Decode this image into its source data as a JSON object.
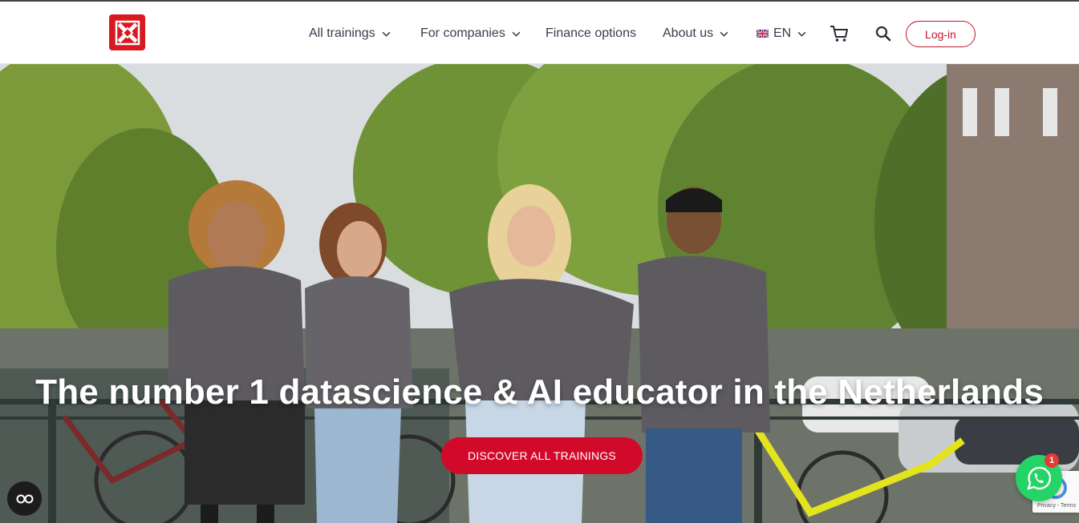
{
  "header": {
    "logo_name": "cross-logo",
    "nav": [
      {
        "label": "All trainings",
        "has_dropdown": true
      },
      {
        "label": "For companies",
        "has_dropdown": true
      },
      {
        "label": "Finance options",
        "has_dropdown": false
      },
      {
        "label": "About us",
        "has_dropdown": true
      },
      {
        "label": "EN",
        "has_dropdown": true
      }
    ],
    "cart_icon": "cart-icon",
    "search_icon": "search-icon",
    "login_label": "Log-in"
  },
  "hero": {
    "headline": "The number 1 datascience & AI educator in the Netherlands",
    "cta_label": "DISCOVER ALL TRAININGS"
  },
  "widgets": {
    "accessibility_icon": "accessibility-icon",
    "whatsapp_icon": "whatsapp-icon",
    "whatsapp_badge": "1",
    "recaptcha_text": "Privacy - Terms"
  },
  "colors": {
    "brand_red": "#d10a2a",
    "nav_text": "#3b3b4f",
    "whatsapp_green": "#25d366"
  }
}
